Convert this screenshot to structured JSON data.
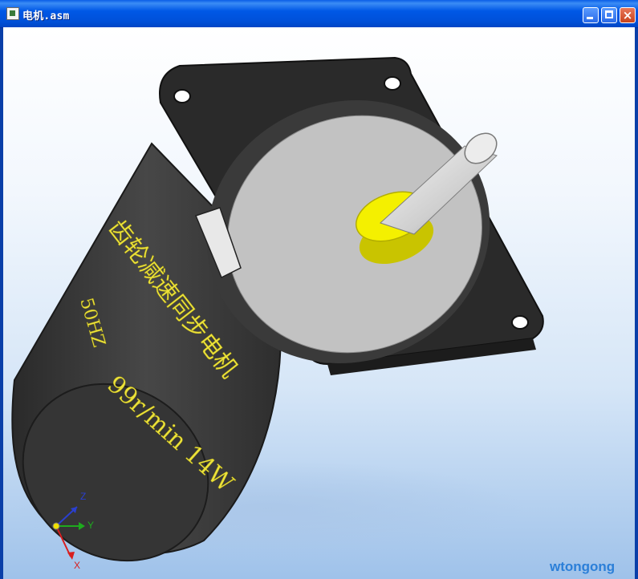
{
  "window": {
    "title": "电机.asm",
    "minimize_symbol": "",
    "maximize_symbol": "",
    "close_symbol": "×"
  },
  "motor_label": {
    "line1": "齿轮减速同步电机",
    "line2": "99r/min 14W",
    "line3": "50HZ"
  },
  "triad": {
    "x": "X",
    "y": "Y",
    "z": "Z"
  },
  "watermark": "wtongong",
  "colors": {
    "body": "#3b3b3b",
    "plate": "#2a2a2a",
    "face": "#c2c2c2",
    "bushing": "#f4f000",
    "shaft": "#d6d6d6",
    "label": "#ece23a"
  }
}
